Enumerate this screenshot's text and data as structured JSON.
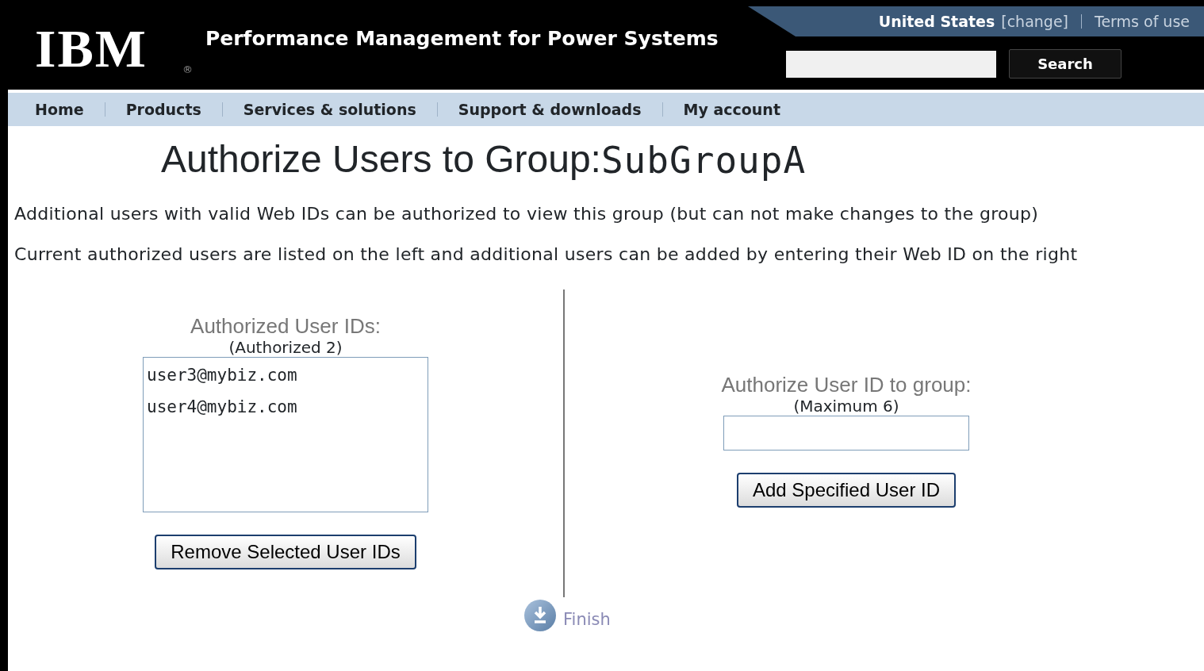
{
  "header": {
    "logo": "IBM",
    "registered": "®",
    "title": "Performance Management for Power Systems",
    "country": "United States",
    "change_link": "[change]",
    "terms_link": "Terms of use",
    "search": {
      "button": "Search"
    }
  },
  "nav": [
    {
      "label": "Home"
    },
    {
      "label": "Products"
    },
    {
      "label": "Services & solutions"
    },
    {
      "label": "Support & downloads"
    },
    {
      "label": "My account"
    }
  ],
  "page": {
    "heading": "Authorize Users to Group:",
    "group_name": "SubGroupA",
    "intro": [
      "Additional users with valid Web IDs can be authorized to view this group (but can not make changes to the group)",
      "Current authorized users are listed on the left and additional users can be added by entering their Web ID on the right"
    ]
  },
  "authorized": {
    "label": "Authorized User IDs:",
    "count": "(Authorized 2)",
    "users": [
      {
        "id": "user3@mybiz.com",
        "selected": false
      },
      {
        "id": "user4@mybiz.com",
        "selected": false
      }
    ],
    "remove_button": "Remove Selected User IDs"
  },
  "add": {
    "label": "Authorize User ID to group:",
    "limit": "(Maximum 6)",
    "add_button": "Add Specified User ID"
  },
  "finish": {
    "label": "Finish"
  }
}
